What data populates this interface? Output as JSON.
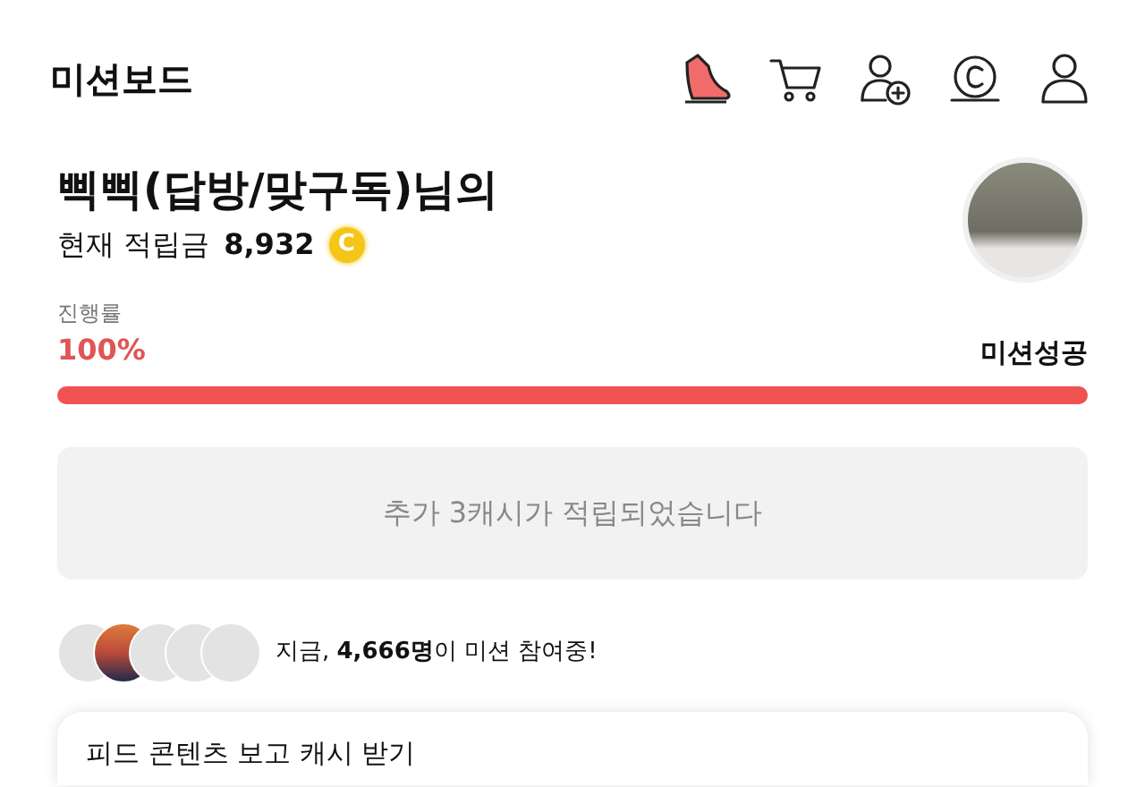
{
  "header": {
    "title": "미션보드"
  },
  "profile": {
    "name": "삑삑(답방/맞구독)님의",
    "points_label": "현재 적립금",
    "points": "8,932",
    "coin_symbol": "C"
  },
  "progress": {
    "label": "진행률",
    "percent": "100%",
    "status": "미션성공",
    "level": 1.0
  },
  "notice": "추가 3캐시가 적립되었습니다",
  "participants": {
    "avatars": [
      {
        "kind": "default"
      },
      {
        "kind": "photo"
      },
      {
        "kind": "default"
      },
      {
        "kind": "default"
      },
      {
        "kind": "default"
      }
    ],
    "text": "지금, **4,666명**이 미션 참여중!"
  },
  "feed_card": {
    "title": "피드 콘텐츠 보고 캐시 받기"
  }
}
